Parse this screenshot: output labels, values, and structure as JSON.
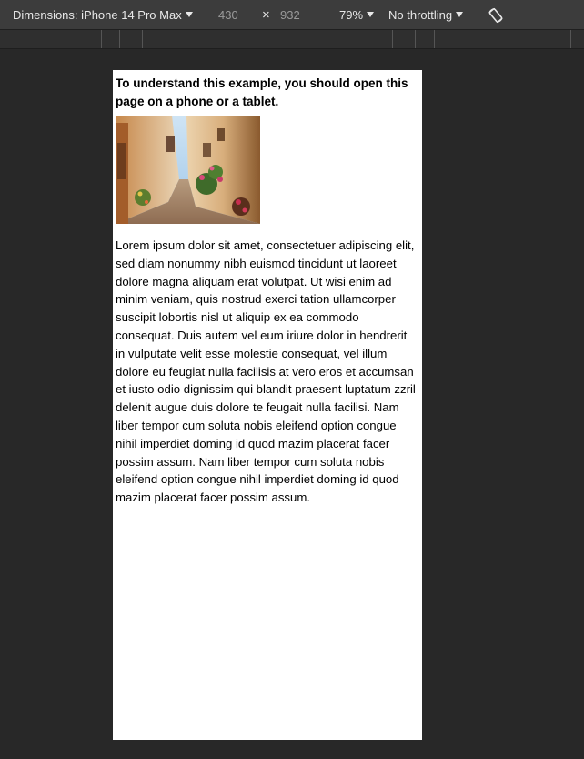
{
  "toolbar": {
    "dimensions_label": "Dimensions: iPhone 14 Pro Max",
    "width_value": "430",
    "times_symbol": "×",
    "height_value": "932",
    "zoom_label": "79%",
    "throttling_label": "No throttling",
    "rotate_icon": "rotate-icon"
  },
  "page": {
    "intro": "To understand this example, you should open this page on a phone or a tablet.",
    "image_alt": "narrow street with flowers",
    "body": "Lorem ipsum dolor sit amet, consectetuer adipiscing elit, sed diam nonummy nibh euismod tincidunt ut laoreet dolore magna aliquam erat volutpat. Ut wisi enim ad minim veniam, quis nostrud exerci tation ullamcorper suscipit lobortis nisl ut aliquip ex ea commodo consequat. Duis autem vel eum iriure dolor in hendrerit in vulputate velit esse molestie consequat, vel illum dolore eu feugiat nulla facilisis at vero eros et accumsan et iusto odio dignissim qui blandit praesent luptatum zzril delenit augue duis dolore te feugait nulla facilisi. Nam liber tempor cum soluta nobis eleifend option congue nihil imperdiet doming id quod mazim placerat facer possim assum. Nam liber tempor cum soluta nobis eleifend option congue nihil imperdiet doming id quod mazim placerat facer possim assum."
  },
  "colors": {
    "toolbar_bg": "#3c3c3c",
    "stage_bg": "#282828",
    "viewport_bg": "#ffffff"
  }
}
